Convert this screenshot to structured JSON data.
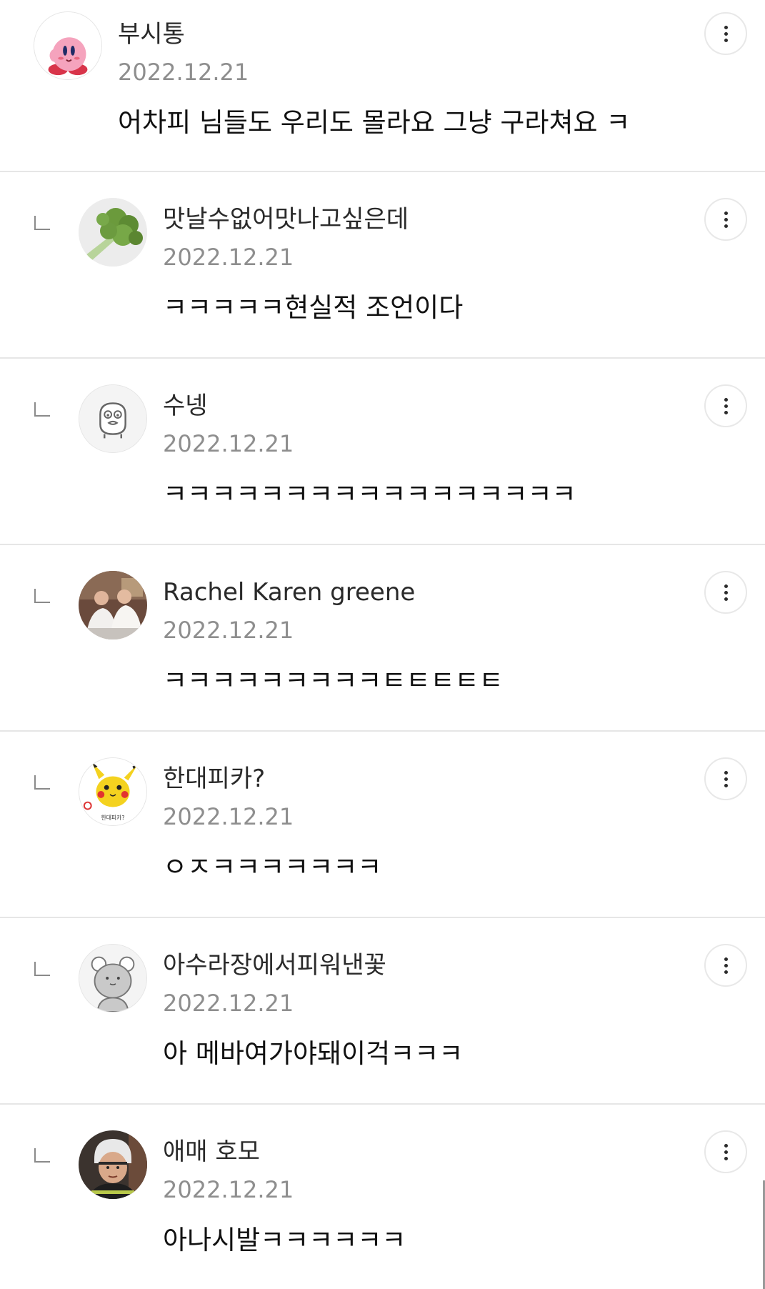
{
  "comments": [
    {
      "username": "부시통",
      "date": "2022.12.21",
      "text": "어차피 님들도 우리도 몰라요 그냥 구라쳐요 ㅋ",
      "avatar_icon": "kirby-avatar-icon",
      "is_reply": false
    },
    {
      "username": "맛날수없어맛나고싶은데",
      "date": "2022.12.21",
      "text": "ㅋㅋㅋㅋㅋ현실적 조언이다",
      "avatar_icon": "broccoli-avatar-icon",
      "is_reply": true
    },
    {
      "username": "수넹",
      "date": "2022.12.21",
      "text": "ㅋㅋㅋㅋㅋㅋㅋㅋㅋㅋㅋㅋㅋㅋㅋㅋㅋ",
      "avatar_icon": "default-character-avatar-icon",
      "is_reply": true
    },
    {
      "username": "Rachel Karen greene",
      "date": "2022.12.21",
      "text": "ㅋㅋㅋㅋㅋㅋㅋㅋㅋㅌㅌㅌㅌㅌ",
      "avatar_icon": "photo-avatar-icon",
      "is_reply": true
    },
    {
      "username": "한대피카?",
      "date": "2022.12.21",
      "text": "ㅇㅈㅋㅋㅋㅋㅋㅋㅋ",
      "avatar_icon": "pikachu-avatar-icon",
      "is_reply": true,
      "avatar_caption": "한대피카?"
    },
    {
      "username": "아수라장에서피워낸꽃",
      "date": "2022.12.21",
      "text": "아 메바여가야돼이걱ㅋㅋㅋ",
      "avatar_icon": "default-bear-avatar-icon",
      "is_reply": true
    },
    {
      "username": "애매 호모",
      "date": "2022.12.21",
      "text": "아나시발ㅋㅋㅋㅋㅋㅋ",
      "avatar_icon": "person-photo-avatar-icon",
      "is_reply": true
    }
  ],
  "colors": {
    "divider": "#e6e6e6",
    "date": "#8e8e8e",
    "text": "#111111"
  }
}
